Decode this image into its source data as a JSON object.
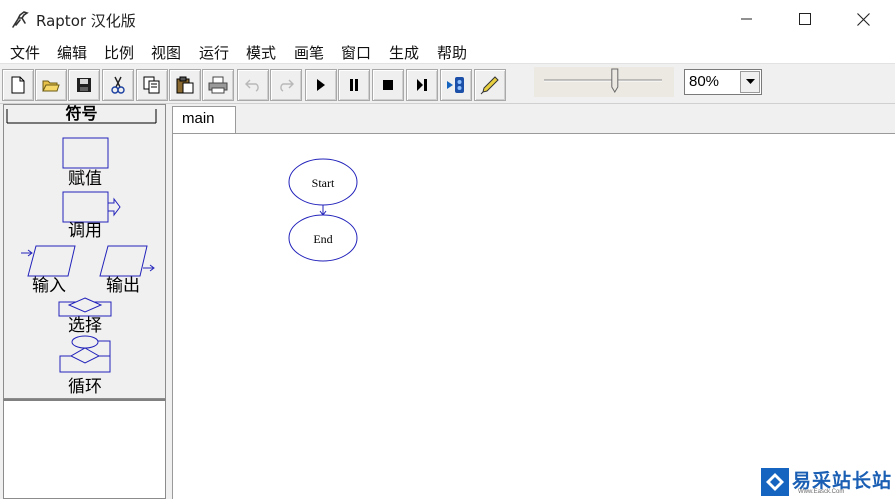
{
  "window": {
    "title": "Raptor 汉化版",
    "icon": "raptor-icon",
    "controls": [
      "minimize-icon",
      "maximize-icon",
      "close-icon"
    ]
  },
  "menu": {
    "items": [
      "文件",
      "编辑",
      "比例",
      "视图",
      "运行",
      "模式",
      "画笔",
      "窗口",
      "生成",
      "帮助"
    ]
  },
  "toolbar": {
    "buttons": [
      {
        "icon": "new-file-icon",
        "enabled": true
      },
      {
        "icon": "open-folder-icon",
        "enabled": true
      },
      {
        "icon": "save-icon",
        "enabled": true
      },
      {
        "icon": "cut-icon",
        "enabled": true
      },
      {
        "icon": "copy-icon",
        "enabled": true
      },
      {
        "icon": "paste-icon",
        "enabled": true
      },
      {
        "icon": "print-icon",
        "enabled": true
      },
      {
        "icon": "undo-icon",
        "enabled": false
      },
      {
        "icon": "redo-icon",
        "enabled": false
      },
      {
        "icon": "run-icon",
        "enabled": true
      },
      {
        "icon": "pause-icon",
        "enabled": true
      },
      {
        "icon": "stop-icon",
        "enabled": true
      },
      {
        "icon": "step-icon",
        "enabled": true
      },
      {
        "icon": "test-server-icon",
        "enabled": true
      },
      {
        "icon": "pen-icon",
        "enabled": true
      }
    ],
    "zoom_slider_level": 0.6,
    "zoom_value": "80%"
  },
  "symbols": {
    "title": "符号",
    "items": {
      "assignment": "赋值",
      "call": "调用",
      "input": "输入",
      "output": "输出",
      "selection": "选择",
      "loop": "循环"
    }
  },
  "tabs": [
    "main"
  ],
  "flowchart": {
    "start_label": "Start",
    "end_label": "End"
  },
  "colors": {
    "shape_stroke": "#2222bb",
    "window_bg": "#f0f0f0",
    "canvas_bg": "#ffffff",
    "watermark_blue": "#1565c0"
  },
  "watermark": {
    "text": "易采站长站",
    "subtext": "Www.Easck.Com"
  }
}
